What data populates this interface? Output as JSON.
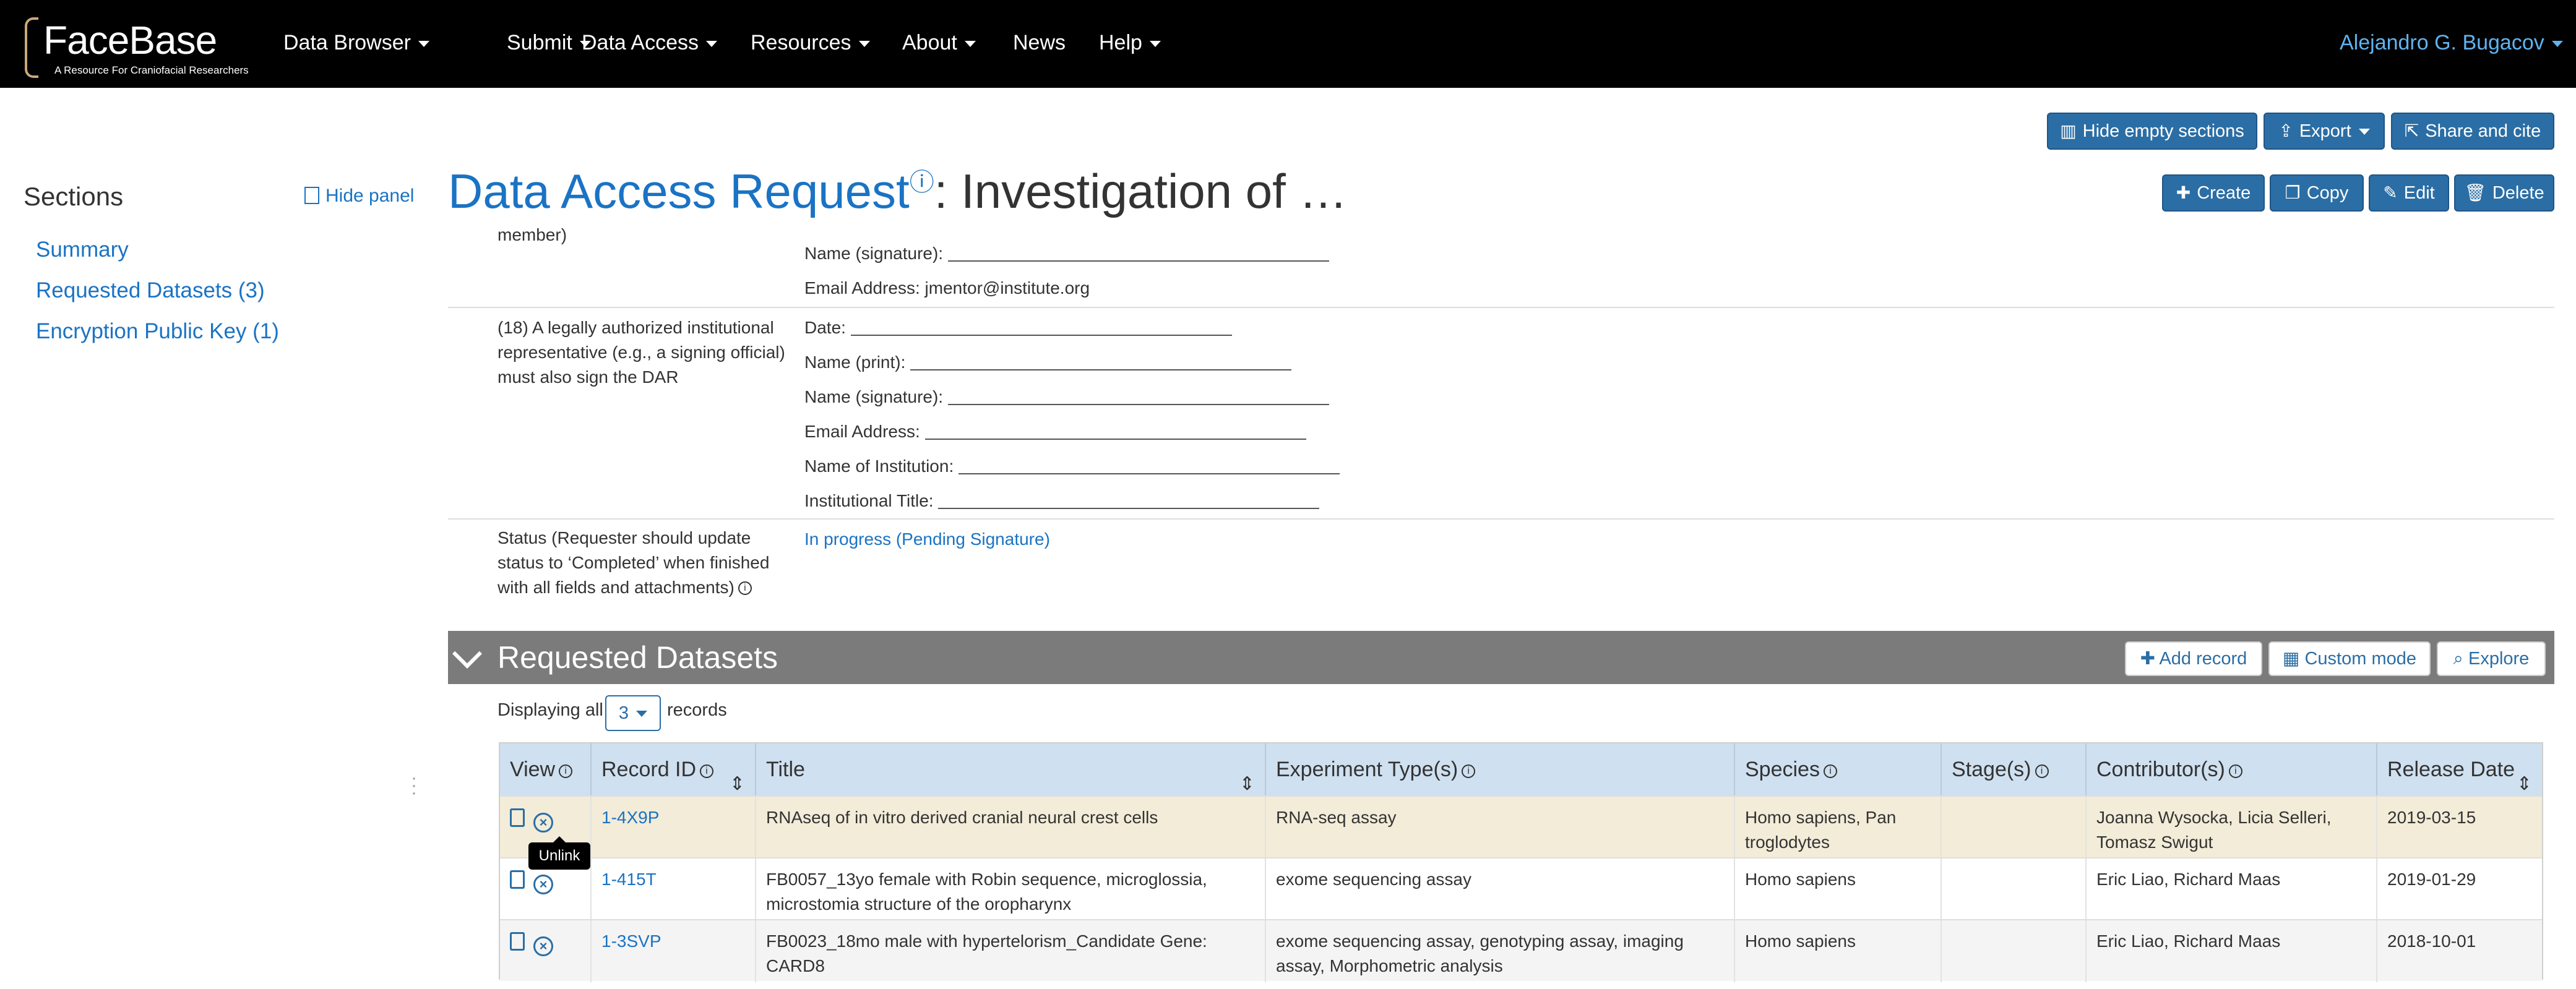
{
  "navbar": {
    "brand": "FaceBase",
    "tagline": "A Resource For Craniofacial Researchers",
    "menu": [
      {
        "label": "Data Browser",
        "has_menu": true
      },
      {
        "label": "Submit",
        "has_menu": true
      },
      {
        "label": "Data Access",
        "has_menu": true
      },
      {
        "label": "Resources",
        "has_menu": true
      },
      {
        "label": "About",
        "has_menu": true
      },
      {
        "label": "News",
        "has_menu": false
      },
      {
        "label": "Help",
        "has_menu": true
      }
    ],
    "user": "Alejandro G. Bugacov"
  },
  "toolbar": {
    "hide_empty": "Hide empty sections",
    "export": "Export",
    "share": "Share and cite",
    "create": "Create",
    "copy": "Copy",
    "edit": "Edit",
    "delete": "Delete"
  },
  "sidebar": {
    "title": "Sections",
    "hide_panel": "Hide panel",
    "items": [
      "Summary",
      "Requested Datasets (3)",
      "Encryption Public Key (1)"
    ]
  },
  "page": {
    "title_link": "Data Access Request",
    "title_info": "ⓘ",
    "title_rest": ": Investigation of …"
  },
  "record": {
    "partial_label": "member)",
    "mentor": {
      "signature_label": "Name (signature):",
      "email_label": "Email Address: jmentor@institute.org"
    },
    "official": {
      "label": "(18) A legally authorized institutional representative (e.g., a signing official) must also sign the DAR",
      "fields": [
        "Date:",
        "Name (print):",
        "Name (signature):",
        "Email Address:",
        "Name of Institution:",
        "Institutional Title:"
      ]
    },
    "status": {
      "label": "Status (Requester should update status to ‘Completed’ when finished with all fields and attachments)",
      "value": "In progress (Pending Signature)"
    }
  },
  "datasets": {
    "title": "Requested Datasets",
    "add_record": "Add record",
    "custom_mode": "Custom mode",
    "explore": "Explore",
    "displaying": "Displaying all",
    "page_size": "3",
    "records_word": "records",
    "columns": [
      "View",
      "Record ID",
      "Title",
      "Experiment Type(s)",
      "Species",
      "Stage(s)",
      "Contributor(s)",
      "Release Date"
    ],
    "rows": [
      {
        "id": "1-4X9P",
        "title": "RNAseq of in vitro derived cranial neural crest cells",
        "experiment": "RNA-seq assay",
        "species": "Homo sapiens, Pan troglodytes",
        "stage": "",
        "contributors": "Joanna Wysocka, Licia Selleri, Tomasz Swigut",
        "release": "2019-03-15"
      },
      {
        "id": "1-415T",
        "title": "FB0057_13yo female with Robin sequence, microglossia, microstomia structure of the oropharynx",
        "experiment": "exome sequencing assay",
        "species": "Homo sapiens",
        "stage": "",
        "contributors": "Eric Liao, Richard Maas",
        "release": "2019-01-29"
      },
      {
        "id": "1-3SVP",
        "title": "FB0023_18mo male with hypertelorism_Candidate Gene: CARD8",
        "experiment": "exome sequencing assay, genotyping assay, imaging assay, Morphometric analysis",
        "species": "Homo sapiens",
        "stage": "",
        "contributors": "Eric Liao, Richard Maas",
        "release": "2018-10-01"
      }
    ],
    "tooltip": "Unlink"
  },
  "colors": {
    "navbar_bg": "#000000",
    "link": "#1a73c4",
    "button": "#2b6ea5",
    "section_header": "#7b7b7b",
    "table_header": "#cfe0f0",
    "hover_row": "#f2ecd8",
    "alt_row": "#f4f4f4"
  }
}
